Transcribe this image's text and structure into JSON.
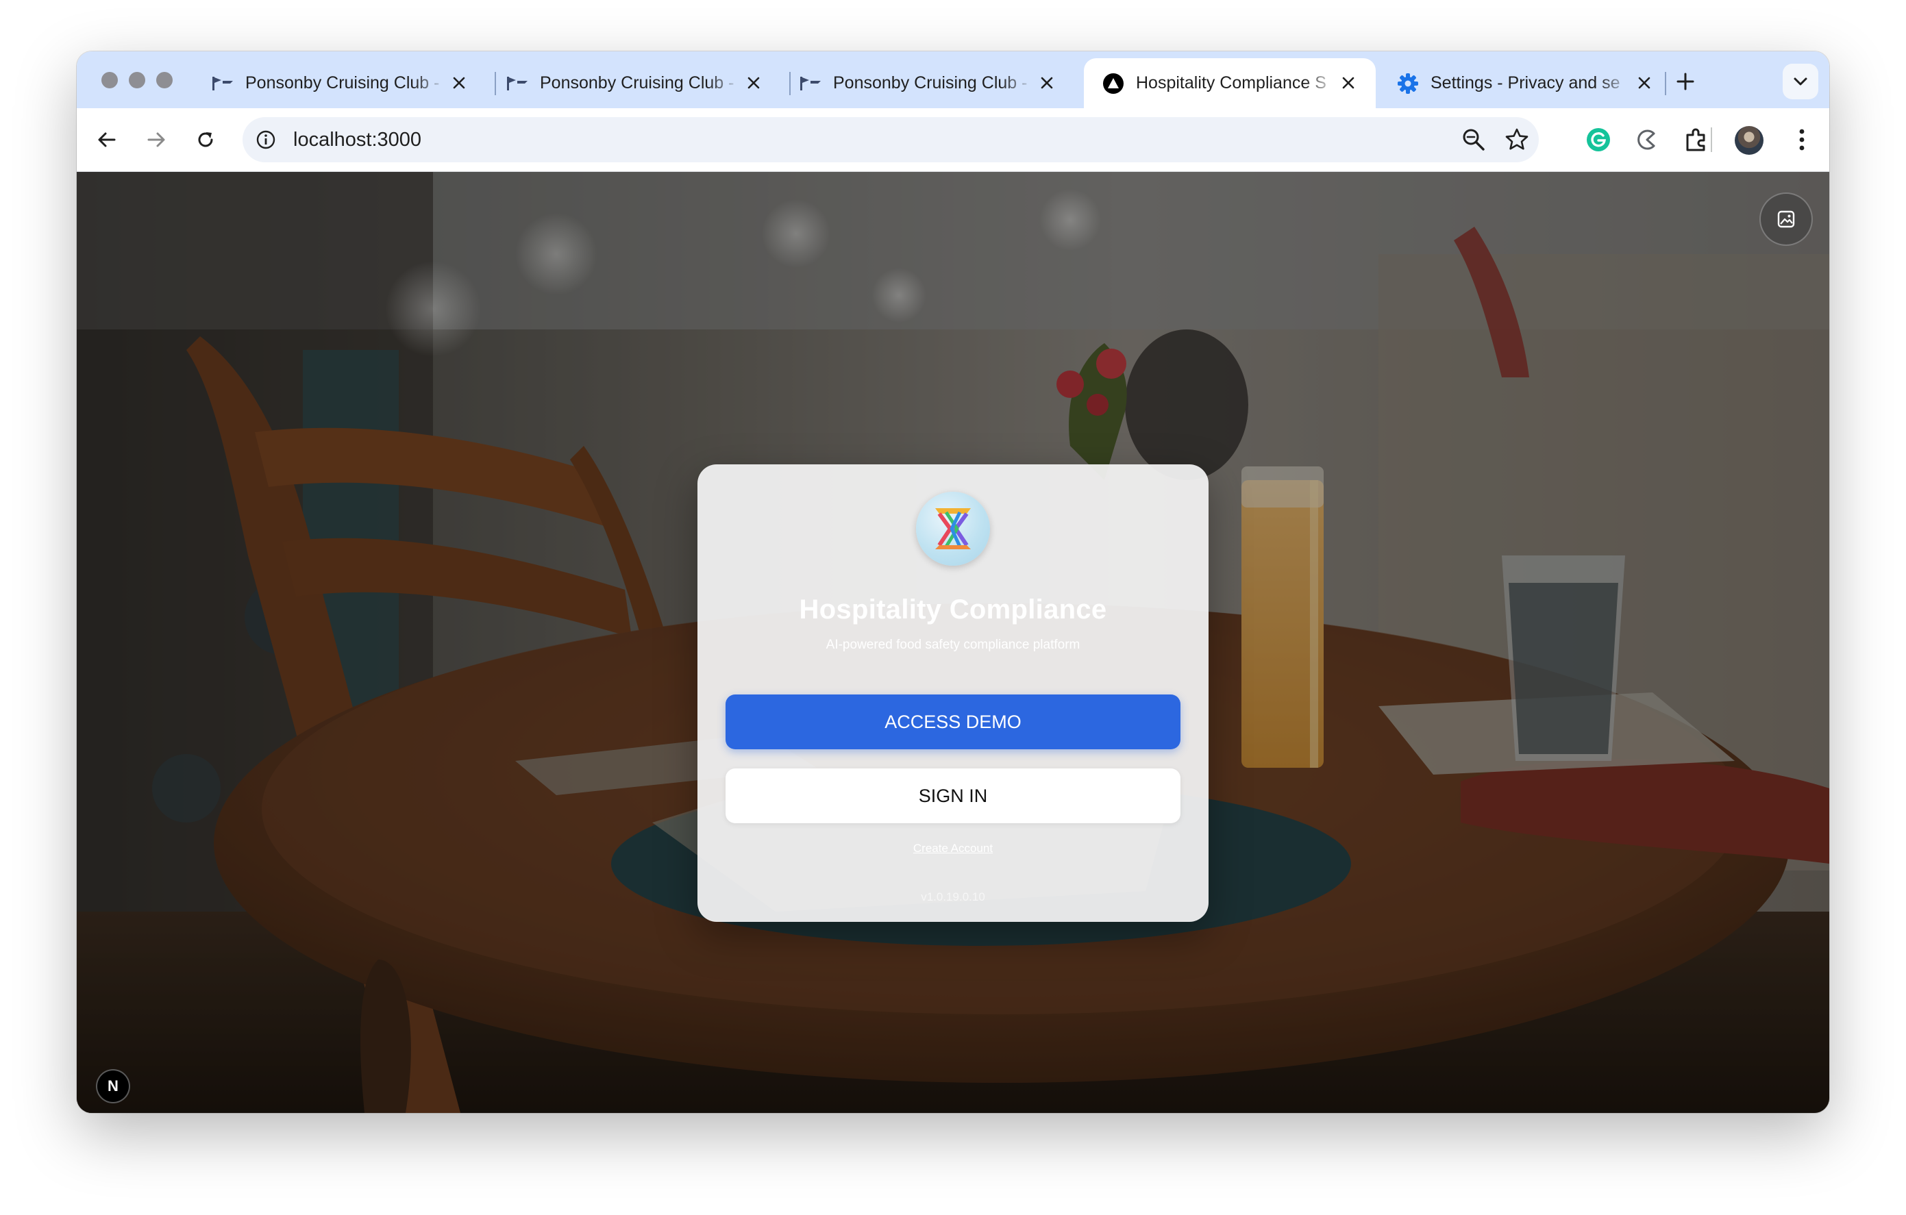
{
  "browser": {
    "tabs": [
      {
        "title": "Ponsonby Cruising Club -",
        "icon": "flag-icon",
        "active": false
      },
      {
        "title": "Ponsonby Cruising Club -",
        "icon": "flag-icon",
        "active": false
      },
      {
        "title": "Ponsonby Cruising Club -",
        "icon": "flag-icon",
        "active": false
      },
      {
        "title": "Hospitality Compliance S",
        "icon": "triangle-logo-icon",
        "active": true
      },
      {
        "title": "Settings - Privacy and se",
        "icon": "gear-icon",
        "active": false
      }
    ],
    "address": {
      "url": "localhost:3000"
    },
    "colors": {
      "tabstrip": "#d3e3fd",
      "active_tab": "#ffffff",
      "settings_icon": "#1a73e8",
      "grammarly": "#15c39a"
    }
  },
  "page": {
    "app_title": "Hospitality Compliance",
    "subtitle": "AI-powered food safety compliance platform",
    "primary_button": "ACCESS DEMO",
    "secondary_button": "SIGN IN",
    "create_account_link": "Create Account",
    "version": "v1.0.19.0.10",
    "next_badge": "N",
    "colors": {
      "primary": "#2c67e0",
      "card": "#f2f2f2"
    }
  }
}
